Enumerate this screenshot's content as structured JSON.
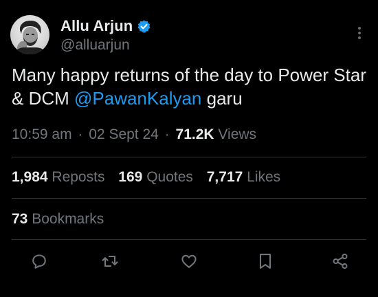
{
  "author": {
    "display_name": "Allu Arjun",
    "handle": "@alluarjun",
    "verified": true
  },
  "tweet": {
    "text_before": "Many happy returns of the day to Power Star & DCM ",
    "mention": "@PawanKalyan",
    "text_after": " garu"
  },
  "meta": {
    "time": "10:59 am",
    "dot": "·",
    "date": "02 Sept 24",
    "views_count": "71.2K",
    "views_label": "Views"
  },
  "stats": {
    "reposts_count": "1,984",
    "reposts_label": "Reposts",
    "quotes_count": "169",
    "quotes_label": "Quotes",
    "likes_count": "7,717",
    "likes_label": "Likes",
    "bookmarks_count": "73",
    "bookmarks_label": "Bookmarks"
  },
  "actions": [
    "reply-icon",
    "repost-icon",
    "like-icon",
    "bookmark-icon",
    "share-icon"
  ],
  "colors": {
    "background": "#000000",
    "text": "#e7e9ea",
    "secondary": "#71767b",
    "accent": "#1d9bf0",
    "divider": "#2f3336"
  }
}
